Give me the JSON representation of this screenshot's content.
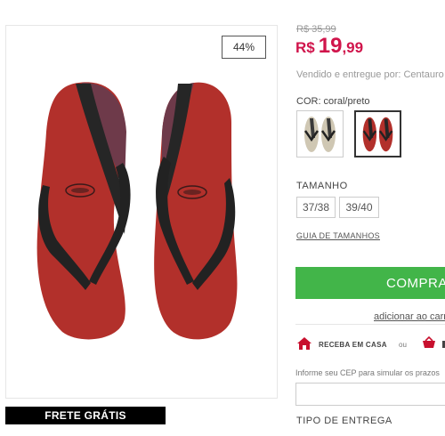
{
  "product": {
    "discount_badge": "44%",
    "old_price": "R$ 35,99",
    "price_currency": "R$",
    "price_integer": "19",
    "price_decimal": ",99",
    "seller": "Vendido e entregue por: Centauro",
    "color_label": "COR: coral/preto",
    "size_label": "TAMANHO",
    "sizes": [
      "37/38",
      "39/40"
    ],
    "size_guide": "GUIA DE TAMANHOS",
    "frete_banner": "FRETE GRÁTIS"
  },
  "actions": {
    "buy_label": "COMPRAR",
    "add_cart_label": "adicionar ao carrinho"
  },
  "delivery": {
    "home_label": "RECEBA EM CASA",
    "or_label": "ou",
    "cep_info": "Informe seu CEP para simular os prazos",
    "tipo_label": "TIPO DE ENTREGA"
  },
  "colors": {
    "price": "#d0144b",
    "buy_button": "#42b549",
    "icon_red": "#c8102e"
  },
  "icons": [
    "home-icon",
    "cart-icon"
  ]
}
